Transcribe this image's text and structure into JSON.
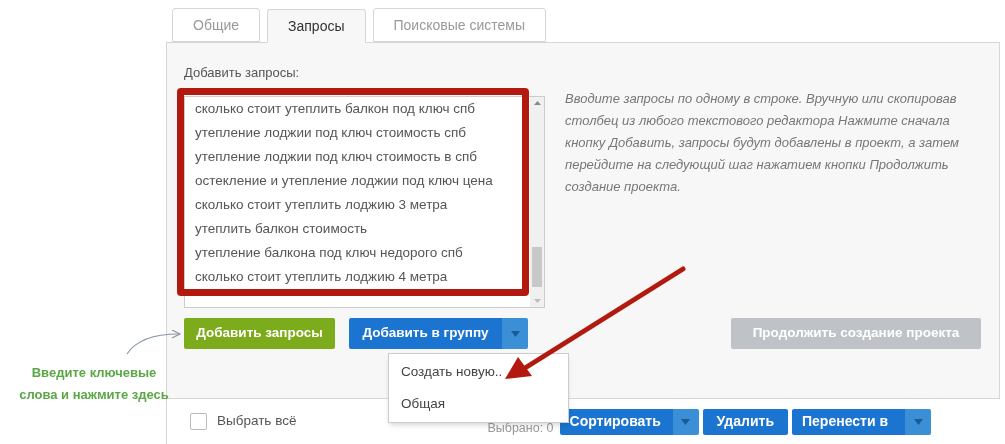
{
  "tabs": [
    {
      "label": "Общие",
      "selected": false
    },
    {
      "label": "Запросы",
      "selected": true
    },
    {
      "label": "Поисковые системы",
      "selected": false
    }
  ],
  "queries": {
    "label": "Добавить запросы:",
    "lines": [
      "сколько стоит утеплить балкон под ключ спб",
      "утепление лоджии под ключ стоимость спб",
      "утепление лоджии под ключ стоимость в спб",
      "остекление и утепление лоджии под ключ цена",
      "сколько стоит утеплить лоджию 3 метра",
      "утеплить балкон стоимость",
      "утепление балкона под ключ недорого спб",
      "сколько стоит утеплить лоджию 4 метра"
    ],
    "hint": "Вводите запросы по одному в строке. Вручную или скопировав столбец из любого текстового редактора Нажмите сначала кнопку Добавить, запросы будут добавлены в проект, а затем перейдите на следующий шаг нажатием кнопки Продолжить создание проекта."
  },
  "actions": {
    "add_queries": "Добавить запросы",
    "add_to_group": "Добавить в группу",
    "continue": {
      "label": "Продолжить создание проекта",
      "disabled": true
    }
  },
  "group_menu": {
    "items": [
      {
        "label": "Создать новую.."
      },
      {
        "label": "Общая"
      }
    ]
  },
  "annotation": "Введите ключевые слова и нажмите здесь",
  "bottom_bar": {
    "select_all": {
      "label": "Выбрать всё",
      "checked": false
    },
    "selected_count": "Выбрано: 0",
    "buttons": [
      {
        "label": "Сортировать",
        "dropdown": true
      },
      {
        "label": "Удалить",
        "dropdown": false
      },
      {
        "label": "Перенести в",
        "dropdown": true
      }
    ]
  }
}
